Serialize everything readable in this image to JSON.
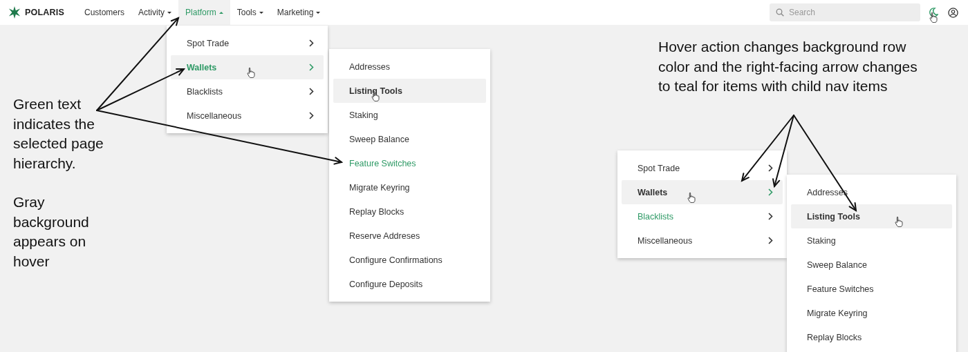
{
  "navbar": {
    "brand": "POLARIS",
    "items": [
      {
        "label": "Customers",
        "dropdown": false,
        "selected": false
      },
      {
        "label": "Activity",
        "dropdown": true,
        "expanded": false,
        "selected": false
      },
      {
        "label": "Platform",
        "dropdown": true,
        "expanded": true,
        "selected": true
      },
      {
        "label": "Tools",
        "dropdown": true,
        "expanded": false,
        "selected": false
      },
      {
        "label": "Marketing",
        "dropdown": true,
        "expanded": false,
        "selected": false
      }
    ],
    "search": {
      "placeholder": "Search"
    }
  },
  "menus": [
    {
      "items": [
        {
          "label": "Spot Trade",
          "has_children": true,
          "selected": false,
          "hovered": false
        },
        {
          "label": "Wallets",
          "has_children": true,
          "selected": true,
          "hovered": true
        },
        {
          "label": "Blacklists",
          "has_children": true,
          "selected": false,
          "hovered": false
        },
        {
          "label": "Miscellaneous",
          "has_children": true,
          "selected": false,
          "hovered": false
        }
      ]
    },
    {
      "items": [
        {
          "label": "Addresses",
          "has_children": false,
          "selected": false,
          "hovered": false
        },
        {
          "label": "Listing Tools",
          "has_children": false,
          "selected": false,
          "hovered": true
        },
        {
          "label": "Staking",
          "has_children": false,
          "selected": false,
          "hovered": false
        },
        {
          "label": "Sweep Balance",
          "has_children": false,
          "selected": false,
          "hovered": false
        },
        {
          "label": "Feature Switches",
          "has_children": false,
          "selected": true,
          "hovered": false
        },
        {
          "label": "Migrate Keyring",
          "has_children": false,
          "selected": false,
          "hovered": false
        },
        {
          "label": "Replay Blocks",
          "has_children": false,
          "selected": false,
          "hovered": false
        },
        {
          "label": "Reserve Addreses",
          "has_children": false,
          "selected": false,
          "hovered": false
        },
        {
          "label": "Configure Confirmations",
          "has_children": false,
          "selected": false,
          "hovered": false
        },
        {
          "label": "Configure Deposits",
          "has_children": false,
          "selected": false,
          "hovered": false
        }
      ]
    },
    {
      "items": [
        {
          "label": "Spot Trade",
          "has_children": true,
          "selected": false,
          "hovered": false
        },
        {
          "label": "Wallets",
          "has_children": true,
          "selected": false,
          "hovered": true
        },
        {
          "label": "Blacklists",
          "has_children": true,
          "selected": true,
          "hovered": false
        },
        {
          "label": "Miscellaneous",
          "has_children": true,
          "selected": false,
          "hovered": false
        }
      ]
    },
    {
      "items": [
        {
          "label": "Addresses",
          "has_children": false,
          "selected": false,
          "hovered": false
        },
        {
          "label": "Listing Tools",
          "has_children": false,
          "selected": false,
          "hovered": true
        },
        {
          "label": "Staking",
          "has_children": false,
          "selected": false,
          "hovered": false
        },
        {
          "label": "Sweep Balance",
          "has_children": false,
          "selected": false,
          "hovered": false
        },
        {
          "label": "Feature Switches",
          "has_children": false,
          "selected": false,
          "hovered": false
        },
        {
          "label": "Migrate Keyring",
          "has_children": false,
          "selected": false,
          "hovered": false
        },
        {
          "label": "Replay Blocks",
          "has_children": false,
          "selected": false,
          "hovered": false
        }
      ]
    }
  ],
  "annotations": [
    {
      "text": "Green text indicates the selected page hierarchy."
    },
    {
      "text": "Gray background appears on hover"
    },
    {
      "text": "Hover action changes background row color and the right-facing arrow changes to teal for items with child nav items"
    }
  ]
}
